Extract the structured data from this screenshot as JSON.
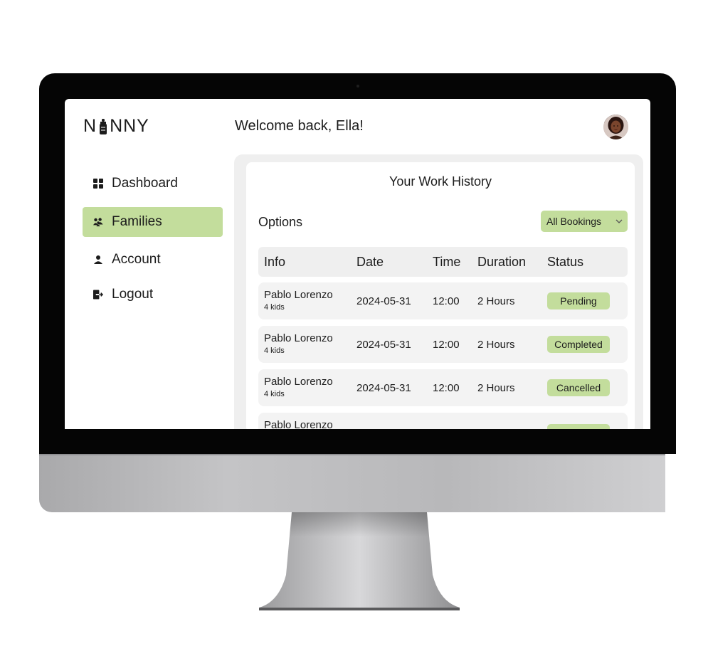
{
  "app": {
    "logo_text_left": "N",
    "logo_text_right": "NNY",
    "welcome": "Welcome back, Ella!",
    "accent_color": "#c3dd9c"
  },
  "sidebar": {
    "items": [
      {
        "label": "Dashboard",
        "icon": "dashboard-grid-icon",
        "active": false
      },
      {
        "label": "Families",
        "icon": "families-group-icon",
        "active": true
      },
      {
        "label": "Account",
        "icon": "person-icon",
        "active": false
      },
      {
        "label": "Logout",
        "icon": "logout-icon",
        "active": false
      }
    ]
  },
  "main": {
    "title": "Your Work History",
    "options_label": "Options",
    "filter": {
      "selected": "All Bookings",
      "icon": "chevron-down-icon"
    },
    "columns": [
      "Info",
      "Date",
      "Time",
      "Duration",
      "Status"
    ],
    "rows": [
      {
        "name": "Pablo Lorenzo",
        "sub": "4 kids",
        "date": "2024-05-31",
        "time": "12:00",
        "duration": "2 Hours",
        "status": "Pending"
      },
      {
        "name": "Pablo Lorenzo",
        "sub": "4 kids",
        "date": "2024-05-31",
        "time": "12:00",
        "duration": "2 Hours",
        "status": "Completed"
      },
      {
        "name": "Pablo Lorenzo",
        "sub": "4 kids",
        "date": "2024-05-31",
        "time": "12:00",
        "duration": "2 Hours",
        "status": "Cancelled"
      },
      {
        "name": "Pablo Lorenzo",
        "sub": "",
        "date": "",
        "time": "",
        "duration": "",
        "status": ""
      }
    ]
  }
}
